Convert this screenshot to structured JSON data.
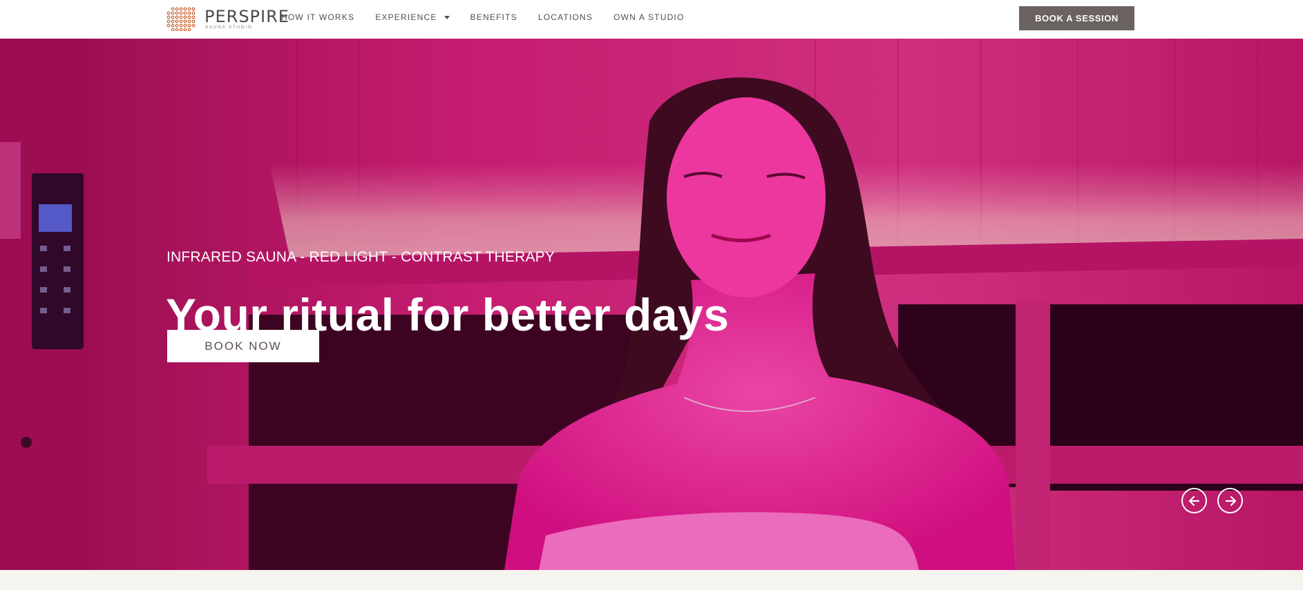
{
  "header": {
    "logo": {
      "wordmark": "PERSPIRE",
      "tagline": "SAUNA STUDIO",
      "icon": "dot-grid-logo-icon",
      "dot_color": "#c9612d"
    },
    "nav": {
      "items": [
        {
          "label": "HOW IT WORKS"
        },
        {
          "label": "EXPERIENCE",
          "has_dropdown": true,
          "icon": "chevron-down-icon"
        },
        {
          "label": "BENEFITS"
        },
        {
          "label": "LOCATIONS"
        },
        {
          "label": "OWN A STUDIO"
        }
      ]
    },
    "cta": {
      "label": "BOOK A SESSION",
      "color": "#6b6361"
    }
  },
  "hero": {
    "eyebrow": "INFRARED SAUNA - RED LIGHT - CONTRAST THERAPY",
    "headline": "Your ritual for better days",
    "cta": {
      "label": "BOOK NOW"
    },
    "image": "woman-relaxing-in-infrared-sauna",
    "tint_color": "#e0128a",
    "carousel": {
      "prev_icon": "arrow-left-icon",
      "next_icon": "arrow-right-icon"
    }
  }
}
